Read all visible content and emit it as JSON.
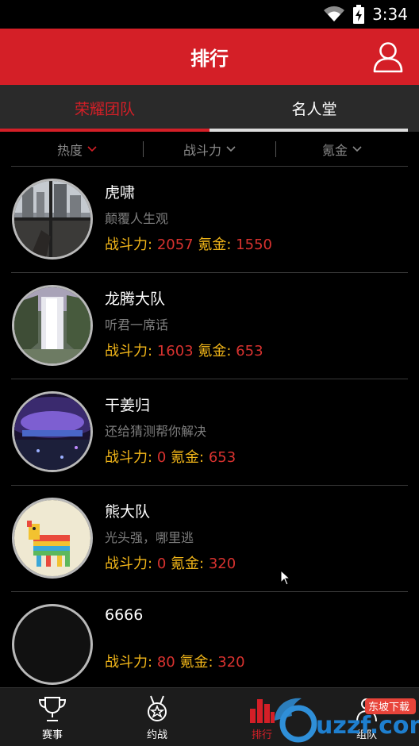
{
  "status_bar": {
    "time": "3:34"
  },
  "header": {
    "title": "排行"
  },
  "tabs": [
    {
      "label": "荣耀团队",
      "active": true
    },
    {
      "label": "名人堂",
      "active": false
    }
  ],
  "filters": [
    {
      "label": "热度"
    },
    {
      "label": "战斗力"
    },
    {
      "label": "氪金"
    }
  ],
  "stat_labels": {
    "power": "战斗力:",
    "gold": "氪金:"
  },
  "teams": [
    {
      "name": "虎啸",
      "slogan": "颠覆人生观",
      "power": "2057",
      "gold": "1550"
    },
    {
      "name": "龙腾大队",
      "slogan": "听君一席话",
      "power": "1603",
      "gold": "653"
    },
    {
      "name": "干姜归",
      "slogan": "还给猜测帮你解决",
      "power": "0",
      "gold": "653"
    },
    {
      "name": "熊大队",
      "slogan": "光头强，哪里逃",
      "power": "0",
      "gold": "320"
    },
    {
      "name": "6666",
      "slogan": "",
      "power": "80",
      "gold": "320"
    }
  ],
  "bottom_nav": [
    {
      "label": "赛事",
      "icon": "trophy-icon",
      "active": false
    },
    {
      "label": "约战",
      "icon": "medal-icon",
      "active": false
    },
    {
      "label": "排行",
      "icon": "bar-chart-icon",
      "active": true
    },
    {
      "label": "组队",
      "icon": "team-icon",
      "active": false
    }
  ],
  "watermark": {
    "text": "uzzf.com",
    "badge": "东坡下载"
  },
  "colors": {
    "accent": "#d41f27",
    "stat_label": "#f2b619",
    "stat_value": "#d8322f"
  }
}
